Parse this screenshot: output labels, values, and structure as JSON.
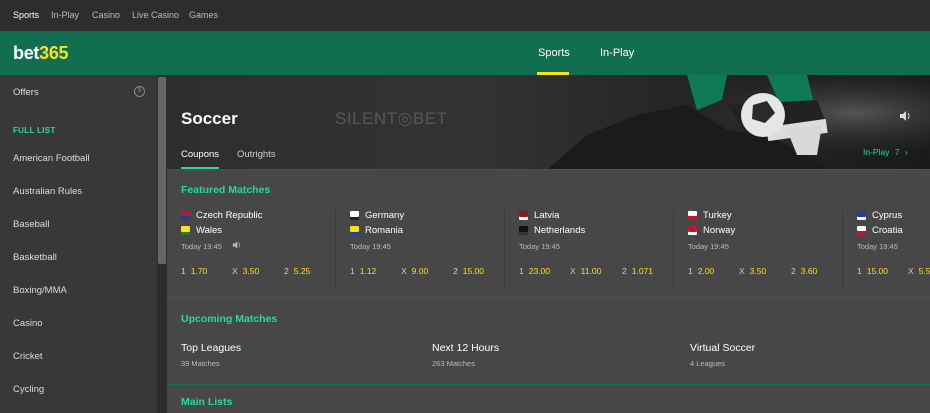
{
  "topbar": {
    "links": [
      "Sports",
      "In-Play",
      "Casino",
      "Live Casino",
      "Games"
    ]
  },
  "header": {
    "logo_part1": "bet",
    "logo_part2": "365",
    "nav": [
      "Sports",
      "In-Play"
    ],
    "accent": "#ffdf1b",
    "brand": "#126e51"
  },
  "sidebar": {
    "offers_label": "Offers",
    "offers_badge": "S",
    "heading": "FULL LIST",
    "items": [
      "American Football",
      "Australian Rules",
      "Baseball",
      "Basketball",
      "Boxing/MMA",
      "Casino",
      "Cricket",
      "Cycling"
    ]
  },
  "hero": {
    "title": "Soccer",
    "watermark": "SILENT◎BET",
    "tabs": [
      "Coupons",
      "Outrights"
    ],
    "inplay_label": "In-Play",
    "inplay_count": "7",
    "chevron": "›"
  },
  "featured": {
    "title": "Featured Matches",
    "matches": [
      {
        "home": "Czech Republic",
        "away": "Wales",
        "time": "Today 19:45",
        "odds": [
          [
            "1",
            "1.70"
          ],
          [
            "X",
            "3.50"
          ],
          [
            "2",
            "5.25"
          ]
        ],
        "home_color": "#c0152a",
        "away_color": "#ffdf1b"
      },
      {
        "home": "Germany",
        "away": "Romania",
        "time": "Today 19:45",
        "odds": [
          [
            "1",
            "1.12"
          ],
          [
            "X",
            "9.00"
          ],
          [
            "2",
            "15.00"
          ]
        ],
        "home_color": "#ffffff",
        "away_color": "#ffdf1b"
      },
      {
        "home": "Latvia",
        "away": "Netherlands",
        "time": "Today 19:45",
        "odds": [
          [
            "1",
            "23.00"
          ],
          [
            "X",
            "11.00"
          ],
          [
            "2",
            "1.071"
          ]
        ],
        "home_color": "#8b1a1a",
        "away_color": "#111111"
      },
      {
        "home": "Turkey",
        "away": "Norway",
        "time": "Today 19:45",
        "odds": [
          [
            "1",
            "2.00"
          ],
          [
            "X",
            "3.50"
          ],
          [
            "2",
            "3.60"
          ]
        ],
        "home_color": "#ffffff",
        "away_color": "#c0152a"
      },
      {
        "home": "Cyprus",
        "away": "Croatia",
        "time": "Today 19:45",
        "odds": [
          [
            "1",
            "15.00"
          ],
          [
            "X",
            "5.5"
          ]
        ],
        "home_color": "#1f3fa8",
        "away_color": "#ffffff"
      }
    ]
  },
  "upcoming": {
    "title": "Upcoming Matches",
    "columns": [
      {
        "title": "Top Leagues",
        "sub": "39 Matches"
      },
      {
        "title": "Next 12 Hours",
        "sub": "263 Matches"
      },
      {
        "title": "Virtual Soccer",
        "sub": "4 Leagues"
      }
    ]
  },
  "main_lists": {
    "title": "Main Lists"
  }
}
